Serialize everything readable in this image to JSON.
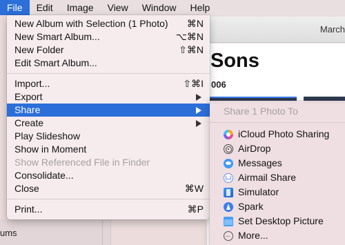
{
  "menubar": {
    "items": [
      {
        "label": "File"
      },
      {
        "label": "Edit"
      },
      {
        "label": "Image"
      },
      {
        "label": "View"
      },
      {
        "label": "Window"
      },
      {
        "label": "Help"
      }
    ],
    "active": "File"
  },
  "background": {
    "toolbar_date": "March",
    "album_title": "Sons",
    "album_subtitle": "006",
    "sidebar_label": "ums"
  },
  "file_menu": {
    "items": [
      {
        "label": "New Album with Selection (1 Photo)",
        "shortcut": "⌘N"
      },
      {
        "label": "New Smart Album...",
        "shortcut": "⌥⌘N"
      },
      {
        "label": "New Folder",
        "shortcut": "⇧⌘N"
      },
      {
        "label": "Edit Smart Album..."
      },
      {
        "label": "Import...",
        "shortcut": "⇧⌘I"
      },
      {
        "label": "Export"
      },
      {
        "label": "Share"
      },
      {
        "label": "Create"
      },
      {
        "label": "Play Slideshow"
      },
      {
        "label": "Show in Moment"
      },
      {
        "label": "Show Referenced File in Finder"
      },
      {
        "label": "Consolidate..."
      },
      {
        "label": "Close",
        "shortcut": "⌘W"
      },
      {
        "label": "Print...",
        "shortcut": "⌘P"
      }
    ]
  },
  "share_menu": {
    "header": "Share 1 Photo To",
    "items": [
      {
        "label": "iCloud Photo Sharing",
        "icon": "icloud-photo-sharing-icon"
      },
      {
        "label": "AirDrop",
        "icon": "airdrop-icon"
      },
      {
        "label": "Messages",
        "icon": "messages-icon"
      },
      {
        "label": "Airmail Share",
        "icon": "airmail-icon"
      },
      {
        "label": "Simulator",
        "icon": "simulator-icon"
      },
      {
        "label": "Spark",
        "icon": "spark-icon"
      },
      {
        "label": "Set Desktop Picture",
        "icon": "desktop-picture-icon"
      },
      {
        "label": "More...",
        "icon": "more-icon"
      }
    ]
  },
  "colors": {
    "highlight": "#2c6fd9",
    "menu_bg": "#f6ecee",
    "disabled_text": "#a79fa1"
  }
}
